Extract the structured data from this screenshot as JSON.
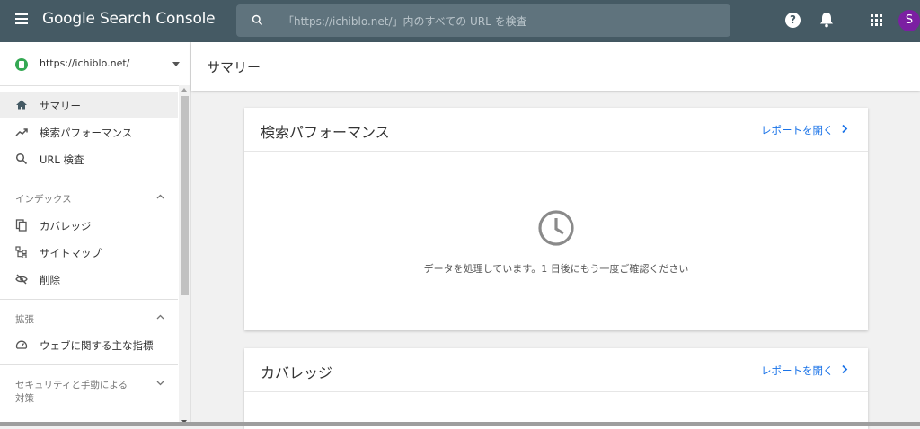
{
  "app": {
    "title": "Google Search Console"
  },
  "search": {
    "placeholder": "「https://ichiblo.net/」内のすべての URL を検査"
  },
  "header": {
    "help": "?",
    "avatar_letter": "S"
  },
  "property": {
    "url": "https://ichiblo.net/"
  },
  "sidebar": {
    "items": [
      {
        "label": "サマリー",
        "icon": "home-icon",
        "active": true
      },
      {
        "label": "検索パフォーマンス",
        "icon": "trending-up-icon"
      },
      {
        "label": "URL 検査",
        "icon": "search-icon"
      }
    ],
    "index_section": {
      "label": "インデックス",
      "items": [
        {
          "label": "カバレッジ",
          "icon": "copy-icon"
        },
        {
          "label": "サイトマップ",
          "icon": "sitemap-icon"
        },
        {
          "label": "削除",
          "icon": "visibility-off-icon"
        }
      ]
    },
    "enhancements_section": {
      "label": "拡張",
      "items": [
        {
          "label": "ウェブに関する主な指標",
          "icon": "speed-icon"
        }
      ]
    },
    "security_section": {
      "label_line1": "セキュリティと手動による",
      "label_line2": "対策"
    }
  },
  "main": {
    "title": "サマリー",
    "cards": [
      {
        "title": "検索パフォーマンス",
        "link": "レポートを開く",
        "message": "データを処理しています。1 日後にもう一度ご確認ください"
      },
      {
        "title": "カバレッジ",
        "link": "レポートを開く"
      }
    ]
  },
  "colors": {
    "topbar": "#455a64",
    "accent": "#1a73e8",
    "avatar": "#7b1fa2",
    "property_icon": "#34a853"
  }
}
